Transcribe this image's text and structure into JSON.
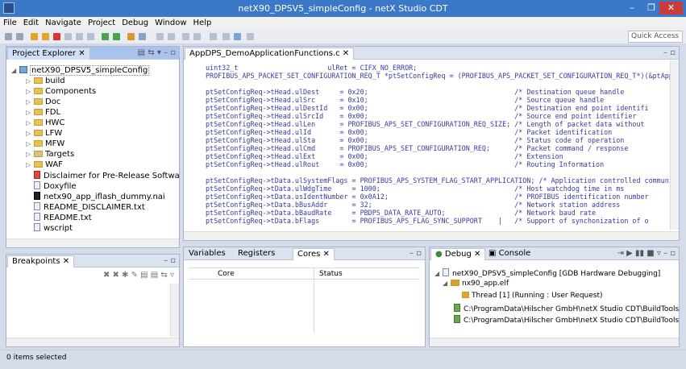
{
  "window": {
    "title": "netX90_DPSV5_simpleConfig - netX Studio CDT",
    "minimize": "–",
    "maximize": "❐",
    "close": "✕"
  },
  "menu": [
    "File",
    "Edit",
    "Navigate",
    "Project",
    "Debug",
    "Window",
    "Help"
  ],
  "toolbar": {
    "quick_access": "Quick Access"
  },
  "project_explorer": {
    "tab": "Project Explorer",
    "root": "netX90_DPSV5_simpleConfig",
    "items": [
      {
        "label": "build",
        "type": "folder"
      },
      {
        "label": "Components",
        "type": "folder"
      },
      {
        "label": "Doc",
        "type": "folder"
      },
      {
        "label": "FDL",
        "type": "folder"
      },
      {
        "label": "HWC",
        "type": "folder"
      },
      {
        "label": "LFW",
        "type": "folder"
      },
      {
        "label": "MFW",
        "type": "folder"
      },
      {
        "label": "Targets",
        "type": "folder"
      },
      {
        "label": "WAF",
        "type": "folder"
      },
      {
        "label": "Disclaimer for Pre-Release Software.pdf",
        "type": "file"
      },
      {
        "label": "Doxyfile",
        "type": "file"
      },
      {
        "label": "netx90_app_iflash_dummy.nai",
        "type": "file"
      },
      {
        "label": "README_DISCLAIMER.txt",
        "type": "file"
      },
      {
        "label": "README.txt",
        "type": "file"
      },
      {
        "label": "wscript",
        "type": "file"
      }
    ]
  },
  "editor": {
    "tab": "AppDPS_DemoApplicationFunctions.c",
    "lines": [
      "uint32_t                      ulRet = CIFX_NO_ERROR;",
      "PROFIBUS_APS_PACKET_SET_CONFIGURATION_REQ_T *ptSetConfigReq = (PROFIBUS_APS_PACKET_SET_CONFIGURATION_REQ_T*)(&ptApp",
      "",
      "ptSetConfigReq->tHead.ulDest     = 0x20;                                    /* Destination queue handle",
      "ptSetConfigReq->tHead.ulSrc      = 0x10;                                    /* Source queue handle",
      "ptSetConfigReq->tHead.ulDestId   = 0x00;                                    /* Destination end point identifi",
      "ptSetConfigReq->tHead.ulSrcId    = 0x00;                                    /* Source end point identifier",
      "ptSetConfigReq->tHead.ulLen      = PROFIBUS_APS_SET_CONFIGURATION_REQ_SIZE; /* Length of packet data without",
      "ptSetConfigReq->tHead.ulId       = 0x00;                                    /* Packet identification",
      "ptSetConfigReq->tHead.ulSta      = 0x00;                                    /* Status code of operation",
      "ptSetConfigReq->tHead.ulCmd      = PROFIBUS_APS_SET_CONFIGURATION_REQ;      /* Packet command / response",
      "ptSetConfigReq->tHead.ulExt      = 0x00;                                    /* Extension",
      "ptSetConfigReq->tHead.ulRout     = 0x00;                                    /* Routing Information",
      "",
      "ptSetConfigReq->tData.ulSystemFlags = PROFIBUS_APS_SYSTEM_FLAG_START_APPLICATION; /* Application controlled communi",
      "ptSetConfigReq->tData.ulWdgTime     = 1000;                                 /* Host watchdog time in ms",
      "ptSetConfigReq->tData.usIdentNumber = 0x0A12;                               /* PROFIBUS identification number",
      "ptSetConfigReq->tData.bBusAddr      = 32;                                   /* Network station address",
      "ptSetConfigReq->tData.bBaudRate     = PBDPS_DATA_RATE_AUTO;                 /* Network baud rate",
      "ptSetConfigReq->tData.bFlags        = PROFIBUS_APS_FLAG_SYNC_SUPPORT    |   /* Support of synchonization of o"
    ]
  },
  "breakpoints": {
    "tab": "Breakpoints"
  },
  "cores_view": {
    "tabs": [
      "Variables",
      "Registers",
      "Cores"
    ],
    "columns": [
      "Core",
      "Status"
    ]
  },
  "debug_view": {
    "tabs": [
      "Debug",
      "Console"
    ],
    "items": [
      "netX90_DPSV5_simpleConfig [GDB Hardware Debugging]",
      "nx90_app.elf",
      "Thread [1] (Running : User Request)",
      "C:\\ProgramData\\Hilscher GmbH\\netX Studio CDT\\BuildTools\\openocd\\",
      "C:\\ProgramData\\Hilscher GmbH\\netX Studio CDT\\BuildTools\\arm-none"
    ]
  },
  "status": {
    "text": "0 items selected"
  }
}
